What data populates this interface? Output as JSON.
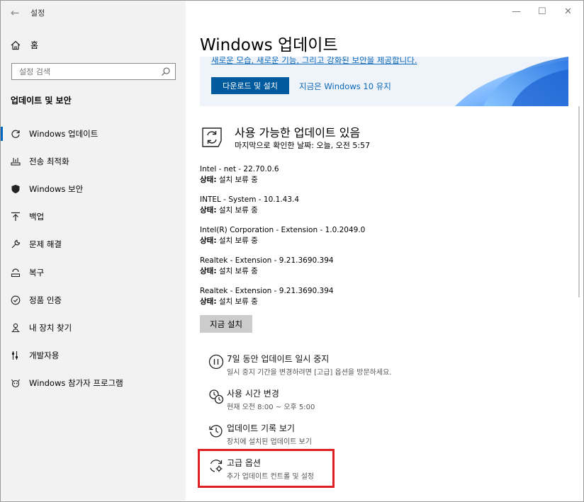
{
  "window": {
    "title": "설정",
    "controls": {
      "minimize": "—",
      "maximize": "☐",
      "close": "✕"
    }
  },
  "sidebar": {
    "home_label": "홈",
    "search_placeholder": "설정 검색",
    "section_title": "업데이트 및 보안",
    "items": [
      {
        "label": "Windows 업데이트",
        "icon": "refresh-icon",
        "active": true
      },
      {
        "label": "전송 최적화",
        "icon": "delivery-optimization-icon"
      },
      {
        "label": "Windows 보안",
        "icon": "shield-icon"
      },
      {
        "label": "백업",
        "icon": "backup-arrow-icon"
      },
      {
        "label": "문제 해결",
        "icon": "wrench-icon"
      },
      {
        "label": "복구",
        "icon": "recovery-icon"
      },
      {
        "label": "정품 인증",
        "icon": "check-circle-icon"
      },
      {
        "label": "내 장치 찾기",
        "icon": "find-device-icon"
      },
      {
        "label": "개발자용",
        "icon": "developer-sliders-icon"
      },
      {
        "label": "Windows 참가자 프로그램",
        "icon": "insider-icon"
      }
    ]
  },
  "main": {
    "title": "Windows 업데이트",
    "banner": {
      "text": "새로운 모습, 새로운 기능, 그리고 강화된 보안을 제공합니다.",
      "download_button": "다운로드 및 설치",
      "stay_link": "지금은 Windows 10 유지"
    },
    "status": {
      "title": "사용 가능한 업데이트 있음",
      "last_checked": "마지막으로 확인한 날짜: 오늘, 오전 5:57"
    },
    "updates": [
      {
        "name": "Intel - net - 22.70.0.6",
        "status_label": "상태:",
        "status_value": " 설치 보류 중"
      },
      {
        "name": "INTEL - System - 10.1.43.4",
        "status_label": "상태:",
        "status_value": " 설치 보류 중"
      },
      {
        "name": "Intel(R) Corporation - Extension - 1.0.2049.0",
        "status_label": "상태:",
        "status_value": " 설치 보류 중"
      },
      {
        "name": "Realtek - Extension - 9.21.3690.394",
        "status_label": "상태:",
        "status_value": " 설치 보류 중"
      },
      {
        "name": "Realtek - Extension - 9.21.3690.394",
        "status_label": "상태:",
        "status_value": " 설치 보류 중"
      }
    ],
    "install_button": "지금 설치",
    "options": [
      {
        "title": "7일 동안 업데이트 일시 중지",
        "subtitle": "일시 중지 기간을 변경하려면 [고급] 옵션을 방문하세요.",
        "icon": "pause-icon"
      },
      {
        "title": "사용 시간 변경",
        "subtitle": "현재 오전 8:00 ~ 오후 5:00",
        "icon": "active-hours-icon"
      },
      {
        "title": "업데이트 기록 보기",
        "subtitle": "장치에 설치된 업데이트 보기",
        "icon": "history-icon"
      },
      {
        "title": "고급 옵션",
        "subtitle": "추가 업데이트 컨트롤 및 설정",
        "icon": "advanced-options-icon"
      }
    ]
  },
  "colors": {
    "accent": "#0067c0",
    "button_blue": "#005a9e",
    "link": "#0a66b7",
    "highlight": "#e02020"
  }
}
